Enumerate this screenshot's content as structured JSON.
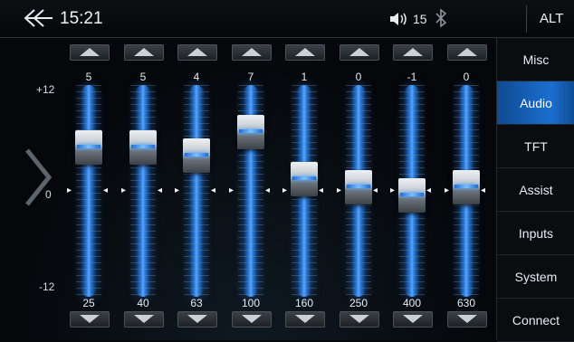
{
  "status": {
    "time": "15:21",
    "volume": "15",
    "alt_label": "ALT"
  },
  "axis": {
    "top": "+12",
    "middle": "0",
    "bottom": "-12",
    "min": -12,
    "max": 12
  },
  "bands": [
    {
      "freq": "25",
      "gain": "5"
    },
    {
      "freq": "40",
      "gain": "5"
    },
    {
      "freq": "63",
      "gain": "4"
    },
    {
      "freq": "100",
      "gain": "7"
    },
    {
      "freq": "160",
      "gain": "1"
    },
    {
      "freq": "250",
      "gain": "0"
    },
    {
      "freq": "400",
      "gain": "-1"
    },
    {
      "freq": "630",
      "gain": "0"
    }
  ],
  "menu": [
    {
      "label": "Misc",
      "active": false
    },
    {
      "label": "Audio",
      "active": true
    },
    {
      "label": "TFT",
      "active": false
    },
    {
      "label": "Assist",
      "active": false
    },
    {
      "label": "Inputs",
      "active": false
    },
    {
      "label": "System",
      "active": false
    },
    {
      "label": "Connect",
      "active": false
    }
  ],
  "icons": {
    "back": "back-arrow-icon",
    "volume": "speaker-icon",
    "bluetooth": "bluetooth-icon",
    "page_left": "chevron-left-icon",
    "up": "triangle-up-icon",
    "down": "triangle-down-icon"
  },
  "colors": {
    "accent": "#1b6fd0",
    "track": "#2a79d9"
  }
}
